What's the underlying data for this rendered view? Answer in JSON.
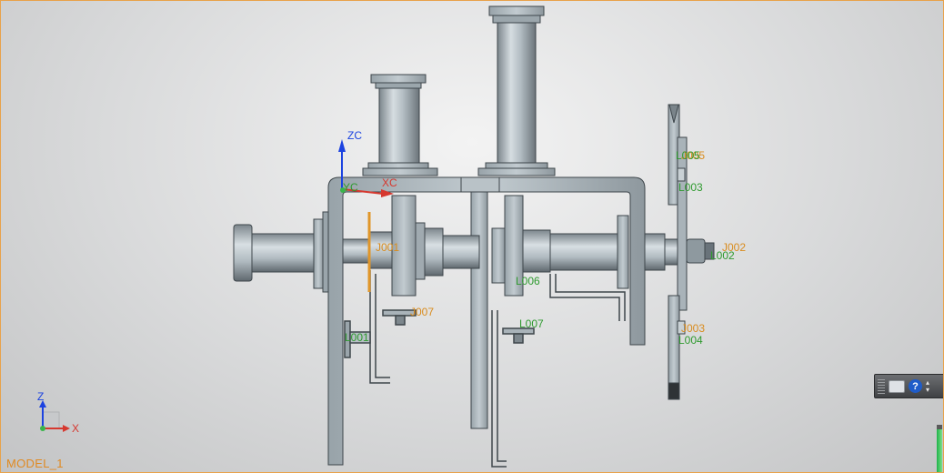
{
  "model_name": "MODEL_1",
  "wcs_labels": {
    "z": "ZC",
    "x": "XC",
    "y": "YC"
  },
  "triad_labels": {
    "z": "Z",
    "x": "X"
  },
  "callouts": [
    {
      "text": "J005",
      "color": "orange"
    },
    {
      "text": "L005",
      "color": "green"
    },
    {
      "text": "L003",
      "color": "green"
    },
    {
      "text": "J002",
      "color": "orange"
    },
    {
      "text": "L002",
      "color": "green"
    },
    {
      "text": "J003",
      "color": "orange"
    },
    {
      "text": "L004",
      "color": "green"
    },
    {
      "text": "J007",
      "color": "orange"
    },
    {
      "text": "L007",
      "color": "green"
    },
    {
      "text": "L006",
      "color": "green"
    },
    {
      "text": "J001",
      "color": "orange"
    },
    {
      "text": "L001",
      "color": "green"
    }
  ],
  "toolbar": {
    "help_label": "?"
  },
  "progress_fraction": 0.9,
  "colors": {
    "accent_orange": "#d98c1e",
    "callout_green": "#2f9a2f",
    "steel": "#aab4ba",
    "border": "#e8a24a"
  }
}
